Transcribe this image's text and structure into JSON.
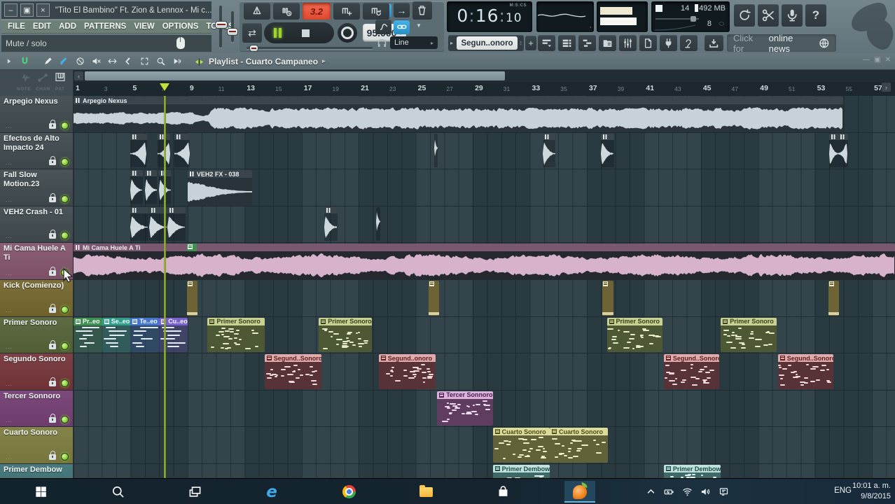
{
  "window": {
    "title": "\"Tito El Bambino\" Ft. Zion & Lennox - Mi c...",
    "buttons": {
      "minimize": "–",
      "restore": "▣",
      "close": "×"
    }
  },
  "menu": {
    "items": [
      "FILE",
      "EDIT",
      "ADD",
      "PATTERNS",
      "VIEW",
      "OPTIONS",
      "TOOLS",
      "?"
    ]
  },
  "hint_bar": {
    "text": "Mute / solo"
  },
  "transport": {
    "row1_buttons": [
      {
        "name": "metronome"
      },
      {
        "name": "wait-for-input"
      },
      {
        "name": "position-display",
        "display": "3.2"
      },
      {
        "name": "countdown"
      },
      {
        "name": "loop-record"
      }
    ],
    "repeat_glyph": "⇄",
    "tempo": "95.000",
    "time": {
      "minutes": "0",
      "seconds": "16",
      "centiseconds": "10",
      "unit_label": "M:S:CS"
    },
    "output_mode": "Line",
    "monitor": {
      "cpu": "14",
      "memory": "492 MB",
      "polyphony": "8"
    },
    "tools": [
      {
        "name": "sync"
      },
      {
        "name": "cut"
      },
      {
        "name": "mic"
      },
      {
        "name": "help",
        "text": "?"
      }
    ]
  },
  "pattern_selector": {
    "value": "Segun..onoro",
    "add_label": "+"
  },
  "panel_buttons": [
    {
      "name": "playlist-panel"
    },
    {
      "name": "channel-rack"
    },
    {
      "name": "piano-roll"
    },
    {
      "name": "browser"
    },
    {
      "name": "mixer"
    },
    {
      "name": "project-picker"
    },
    {
      "name": "plugin-picker"
    },
    {
      "name": "touch-controller"
    }
  ],
  "news_bar": {
    "prefix": "Click for",
    "highlight": "online news"
  },
  "playlist": {
    "title": "Playlist - Cuarto Campaneo",
    "title_arrow": "▸",
    "corner_labels": [
      "NOTE",
      "CHAN",
      "PAT"
    ],
    "toolbar_icons": [
      {
        "name": "menu-arrow",
        "color": "#cfd9db"
      },
      {
        "name": "magnet",
        "color": "#4bd17f"
      },
      {
        "name": "pencil",
        "color": "#e2e9ea"
      },
      {
        "name": "paint-brush",
        "color": "#41b1ea"
      },
      {
        "name": "delete",
        "color": "#e2e9ea"
      },
      {
        "name": "mute",
        "color": "#e2e9ea"
      },
      {
        "name": "slip",
        "color": "#e2e9ea"
      },
      {
        "name": "slice",
        "color": "#e2e9ea"
      },
      {
        "name": "select",
        "color": "#e2e9ea"
      },
      {
        "name": "zoom",
        "color": "#e2e9ea"
      },
      {
        "name": "playback-preview",
        "color": "#e2e9ea"
      }
    ]
  },
  "timeline": {
    "first_bar": 1,
    "last_bar": 57,
    "label_step": 2,
    "major_step": 4,
    "playhead_bar": 7.4
  },
  "tracks": [
    {
      "name": "Arpegio Nexus",
      "color": "#4b5458"
    },
    {
      "name": "Efectos de Alto Impacto 24",
      "color": "#4b5458"
    },
    {
      "name": "Fall Slow Motion.23",
      "color": "#4b5458"
    },
    {
      "name": "VEH2 Crash - 01",
      "color": "#4b5458"
    },
    {
      "name": "Mi Cama Huele A Ti",
      "color": "#8a5f76"
    },
    {
      "name": "Kick (Comienzo)",
      "color": "#7c6f3a"
    },
    {
      "name": "Primer Sonoro",
      "color": "#5e6b43"
    },
    {
      "name": "Segundo Sonoro",
      "color": "#7c4045"
    },
    {
      "name": "Tercer Sonnoro",
      "color": "#7b4a7b"
    },
    {
      "name": "Cuarto Sonoro",
      "color": "#83834a"
    },
    {
      "name": "Primer Dembow",
      "color": "#497a7d"
    }
  ],
  "palettes": {
    "gray_audio": {
      "head": "#3a454b",
      "head_text": "#e8eef0",
      "body": "#29333a",
      "wave": "#c6d2d8"
    },
    "pink_audio": {
      "head": "#7a5970",
      "head_text": "#f2e6ee",
      "body": "#25292f",
      "wave": "#d6b3cb"
    },
    "primer": {
      "head": "#c9d190",
      "head_text": "#394120",
      "body": "#4d5935",
      "notes": "#e6edc4"
    },
    "segundo": {
      "head": "#e2abab",
      "head_text": "#581f1f",
      "body": "#573337",
      "notes": "#f2dada"
    },
    "tercer": {
      "head": "#dcb2dc",
      "head_text": "#4c2150",
      "body": "#5e3d60",
      "notes": "#eed9f0"
    },
    "cuarto": {
      "head": "#dcdc9a",
      "head_text": "#4a4a1d",
      "body": "#62623a",
      "notes": "#f0f0c8"
    },
    "dembow": {
      "head": "#bfe0dc",
      "head_text": "#1d4a47",
      "body": "#3e6966",
      "notes": "#dff2ef"
    },
    "kick": {
      "body": "#6d6334",
      "bar": "#d9d2a0"
    },
    "chip": {
      "body": "#3f9150"
    },
    "crash": {
      "head": "#3a454b",
      "wave": "#cdd8dc",
      "body": "rgba(16,24,28,0.35)"
    }
  },
  "clips": [
    {
      "track": 0,
      "type": "audio",
      "label": "Arpegio Nexus",
      "start": 1,
      "len": 54,
      "palette": "gray_audio",
      "seed": 7,
      "env": "arpegio"
    },
    {
      "track": 1,
      "type": "crash",
      "start": 5,
      "len": 1.15,
      "dir": -1
    },
    {
      "track": 1,
      "type": "crash",
      "start": 6.9,
      "len": 0.9,
      "dir": -1
    },
    {
      "track": 1,
      "type": "crash",
      "start": 8.05,
      "len": 1.1,
      "dir": -1
    },
    {
      "track": 1,
      "type": "crash",
      "start": 26.3,
      "len": 0.25,
      "dir": 1,
      "nohead": true
    },
    {
      "track": 1,
      "type": "crash",
      "start": 33.9,
      "len": 0.9,
      "dir": 1
    },
    {
      "track": 1,
      "type": "crash",
      "start": 38.0,
      "len": 0.9,
      "dir": 1
    },
    {
      "track": 1,
      "type": "crash",
      "start": 54.0,
      "len": 0.65,
      "dir": 1
    },
    {
      "track": 1,
      "type": "crash",
      "start": 54.65,
      "len": 0.65,
      "dir": -1
    },
    {
      "track": 2,
      "type": "crash",
      "start": 5.0,
      "len": 0.85,
      "dir": 1
    },
    {
      "track": 2,
      "type": "crash",
      "start": 6.0,
      "len": 0.85,
      "dir": 1
    },
    {
      "track": 2,
      "type": "crash",
      "start": 7.0,
      "len": 0.85,
      "dir": 1
    },
    {
      "track": 2,
      "type": "audio",
      "label": "VEH2 FX - 038",
      "start": 9,
      "len": 4.5,
      "palette": "gray_audio",
      "seed": 5,
      "env": "decay"
    },
    {
      "track": 3,
      "type": "crash",
      "start": 5.0,
      "len": 1.25,
      "dir": 1
    },
    {
      "track": 3,
      "type": "crash",
      "start": 6.3,
      "len": 1.25,
      "dir": 1
    },
    {
      "track": 3,
      "type": "crash",
      "start": 7.6,
      "len": 1.25,
      "dir": 1
    },
    {
      "track": 3,
      "type": "crash",
      "start": 18.6,
      "len": 0.9,
      "dir": 1
    },
    {
      "track": 3,
      "type": "crash",
      "start": 22.2,
      "len": 0.3,
      "dir": 1,
      "nohead": true
    },
    {
      "track": 4,
      "type": "audio",
      "label": "Mi Cama Huele A Ti",
      "start": 1,
      "len": 57.7,
      "palette": "pink_audio",
      "seed": 13,
      "env": "dense"
    },
    {
      "track": 4,
      "type": "chip",
      "start": 8.95,
      "len": 0.7
    },
    {
      "track": 5,
      "type": "kick",
      "start": 8.95,
      "len": 0.75
    },
    {
      "track": 5,
      "type": "kick",
      "start": 25.9,
      "len": 0.75
    },
    {
      "track": 5,
      "type": "kick",
      "start": 38.1,
      "len": 0.75
    },
    {
      "track": 5,
      "type": "kick",
      "start": 53.95,
      "len": 0.75
    },
    {
      "track": 6,
      "type": "mini",
      "label": "Pr..eo",
      "start": 1,
      "len": 2,
      "color": "#3f9150"
    },
    {
      "track": 6,
      "type": "mini",
      "label": "Se..eo",
      "start": 3,
      "len": 2,
      "color": "#2f9f8c"
    },
    {
      "track": 6,
      "type": "mini",
      "label": "Te..eo",
      "start": 5,
      "len": 2,
      "color": "#4377cf"
    },
    {
      "track": 6,
      "type": "mini",
      "label": "Cu..eo",
      "start": 7,
      "len": 2,
      "color": "#7a60d0"
    },
    {
      "track": 6,
      "type": "pattern",
      "label": "Primer Sonoro",
      "start": 10.4,
      "len": 4,
      "palette": "primer"
    },
    {
      "track": 6,
      "type": "pattern",
      "label": "Primer Sonoro",
      "start": 18.2,
      "len": 3.7,
      "palette": "primer"
    },
    {
      "track": 6,
      "type": "pattern",
      "label": "Primer Sonoro",
      "start": 38.4,
      "len": 3.9,
      "palette": "primer"
    },
    {
      "track": 6,
      "type": "pattern",
      "label": "Primer Sonoro",
      "start": 46.4,
      "len": 3.9,
      "palette": "primer"
    },
    {
      "track": 7,
      "type": "pattern",
      "label": "Segund..Sonoro",
      "start": 14.4,
      "len": 4,
      "palette": "segundo"
    },
    {
      "track": 7,
      "type": "pattern",
      "label": "Segund..onoro",
      "start": 22.4,
      "len": 4,
      "palette": "segundo"
    },
    {
      "track": 7,
      "type": "pattern",
      "label": "Segund..Sonoro",
      "start": 42.4,
      "len": 3.9,
      "palette": "segundo"
    },
    {
      "track": 7,
      "type": "pattern",
      "label": "Segund..Sonoro",
      "start": 50.4,
      "len": 3.9,
      "palette": "segundo"
    },
    {
      "track": 8,
      "type": "pattern",
      "label": "Tercer Sonnoro",
      "start": 26.5,
      "len": 3.9,
      "palette": "tercer"
    },
    {
      "track": 9,
      "type": "pattern",
      "label": "Cuarto Sonoro",
      "start": 30.4,
      "len": 4,
      "palette": "cuarto"
    },
    {
      "track": 9,
      "type": "pattern",
      "label": "Cuarto Sonoro",
      "start": 34.4,
      "len": 4.1,
      "palette": "cuarto"
    },
    {
      "track": 10,
      "type": "pattern",
      "label": "Primer Dembow",
      "start": 30.4,
      "len": 4,
      "palette": "dembow"
    },
    {
      "track": 10,
      "type": "pattern",
      "label": "Primer Dembow",
      "start": 42.4,
      "len": 4,
      "palette": "dembow"
    }
  ],
  "taskbar": {
    "items": [
      "start",
      "search",
      "task-view",
      "edge",
      "chrome",
      "file-explorer",
      "store",
      "fl-studio"
    ],
    "active_item": "fl-studio",
    "tray_icons": [
      "chevron-up",
      "battery",
      "wifi",
      "volume",
      "action-center"
    ],
    "language": "ENG",
    "clock_time": "10:01 a. m.",
    "clock_date": "9/8/2015"
  }
}
